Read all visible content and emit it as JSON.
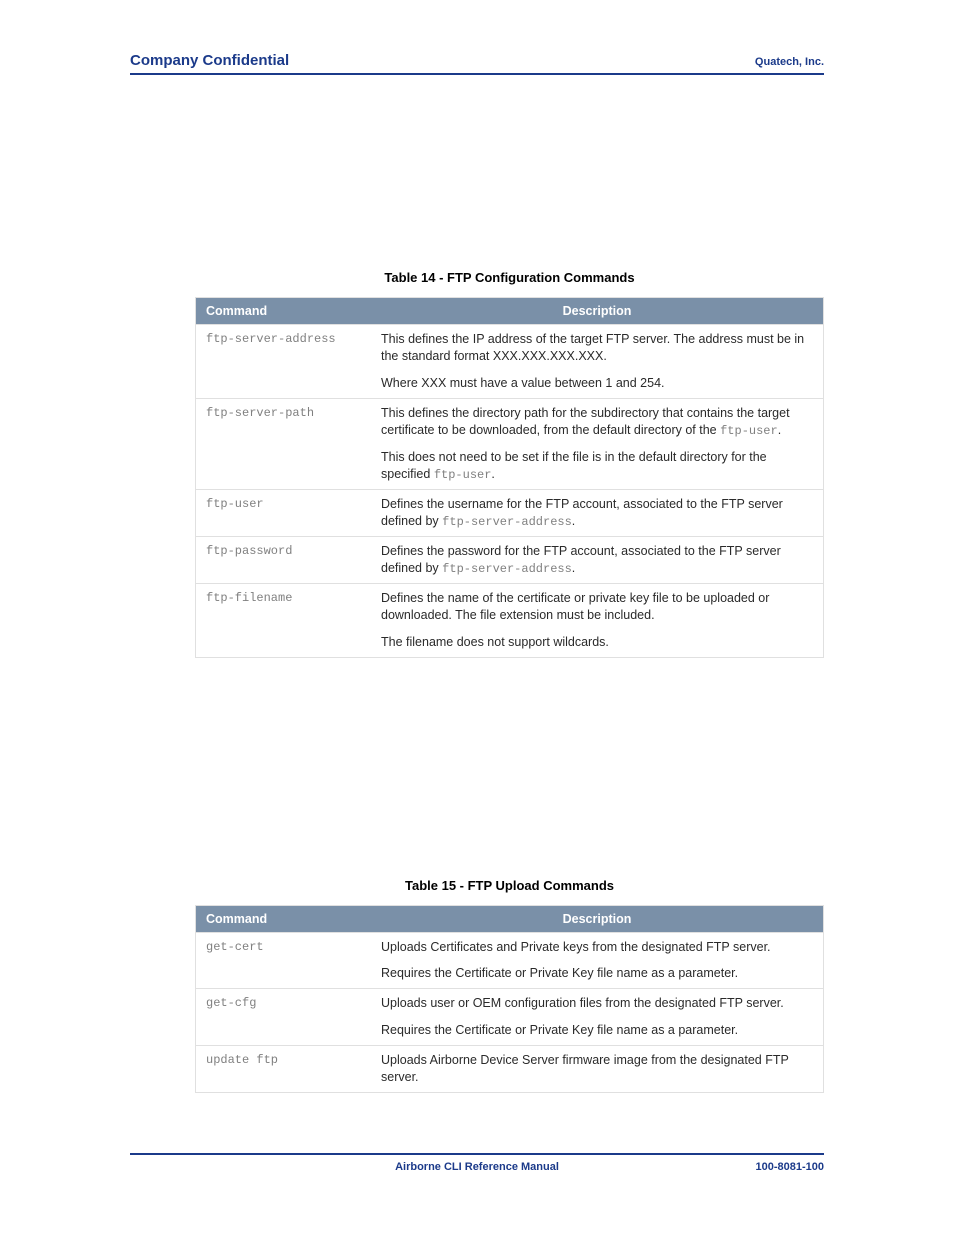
{
  "header": {
    "left": "Company Confidential",
    "right": "Quatech, Inc."
  },
  "tables": [
    {
      "title": "Table 14 - FTP Configuration Commands",
      "head": {
        "col1": "Command",
        "col2": "Description"
      },
      "rows": [
        {
          "cmd": "ftp-server-address",
          "p1": "This defines the IP address of the target FTP server. The address must be in the standard format XXX.XXX.XXX.XXX.",
          "p2": "Where XXX must have a value between 1 and 254."
        },
        {
          "cmd": "ftp-server-path",
          "p1a": "This defines the directory path for the subdirectory that contains the target certificate to be downloaded, from the default directory of the ",
          "p1code": "ftp-user",
          "p1b": ".",
          "p2a": "This does not need to be set if the file is in the default directory for the specified ",
          "p2code": "ftp-user",
          "p2b": "."
        },
        {
          "cmd": "ftp-user",
          "p1a": "Defines the username for the FTP account, associated to the FTP server defined by ",
          "p1code": "ftp-server-address",
          "p1b": "."
        },
        {
          "cmd": "ftp-password",
          "p1a": "Defines the password for the FTP account, associated to the FTP server defined by ",
          "p1code": "ftp-server-address",
          "p1b": "."
        },
        {
          "cmd": "ftp-filename",
          "p1": "Defines the name of the certificate or private key file to be uploaded or downloaded. The file extension must be included.",
          "p2": "The filename does not support wildcards."
        }
      ]
    },
    {
      "title": "Table 15 - FTP Upload Commands",
      "head": {
        "col1": "Command",
        "col2": "Description"
      },
      "rows": [
        {
          "cmd": "get-cert",
          "p1": "Uploads Certificates and Private keys from the designated FTP server.",
          "p2": "Requires the Certificate or Private Key file name as a parameter."
        },
        {
          "cmd": "get-cfg",
          "p1": "Uploads user or OEM configuration files from the designated FTP server.",
          "p2": "Requires the Certificate or Private Key file name as a parameter."
        },
        {
          "cmd": "update ftp",
          "p1": "Uploads Airborne Device Server firmware image from the designated FTP server."
        }
      ]
    }
  ],
  "footer": {
    "center": "Airborne CLI Reference Manual",
    "right": "100-8081-100"
  }
}
